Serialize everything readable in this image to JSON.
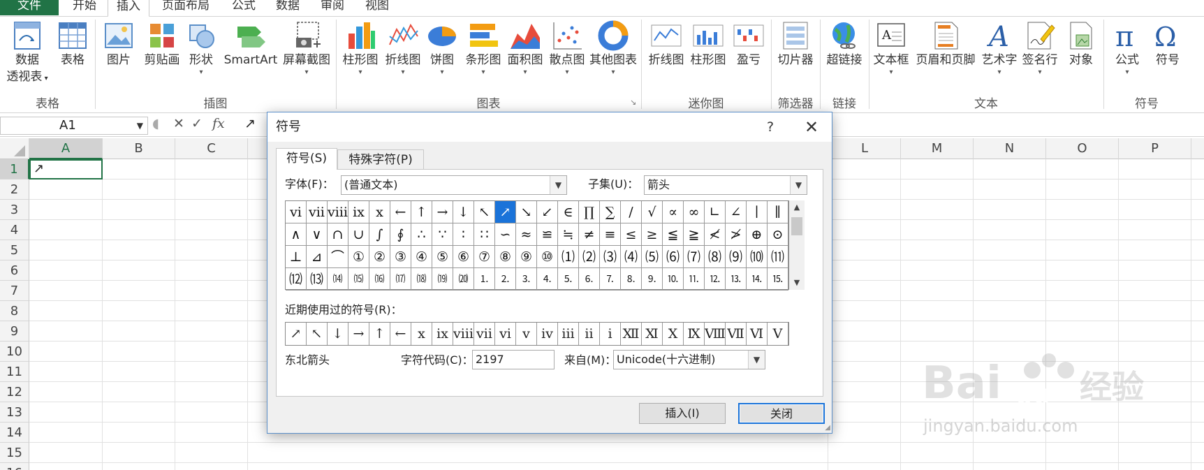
{
  "menu": {
    "tabs": [
      "文件",
      "开始",
      "插入",
      "页面布局",
      "公式",
      "数据",
      "审阅",
      "视图"
    ],
    "active": "插入"
  },
  "ribbon": {
    "table_group": {
      "label": "表格",
      "pivot_label_1": "数据",
      "pivot_label_2": "透视表",
      "table_label": "表格"
    },
    "illustrations_group": {
      "label": "插图",
      "picture": "图片",
      "clipart": "剪贴画",
      "shapes": "形状",
      "smartart": "SmartArt",
      "screenshot": "屏幕截图"
    },
    "charts_group": {
      "label": "图表",
      "column": "柱形图",
      "line": "折线图",
      "pie": "饼图",
      "bar": "条形图",
      "area": "面积图",
      "scatter": "散点图",
      "other": "其他图表"
    },
    "sparklines_group": {
      "label": "迷你图",
      "line": "折线图",
      "column": "柱形图",
      "winloss": "盈亏"
    },
    "filter_group": {
      "label": "筛选器",
      "slicer": "切片器"
    },
    "links_group": {
      "label": "链接",
      "hyperlink": "超链接"
    },
    "text_group": {
      "label": "文本",
      "textbox": "文本框",
      "header_footer": "页眉和页脚",
      "wordart": "艺术字",
      "signature": "签名行",
      "object": "对象"
    },
    "symbols_group": {
      "label": "符号",
      "equation": "公式",
      "symbol": "符号"
    }
  },
  "formula_bar": {
    "name_box": "A1",
    "content": "↗"
  },
  "sheet": {
    "columns": [
      "A",
      "B",
      "C",
      "",
      "",
      "",
      "",
      "",
      "",
      "",
      "",
      "L",
      "M",
      "N",
      "O",
      "P"
    ],
    "rows": [
      "1",
      "2",
      "3",
      "4",
      "5",
      "6",
      "7",
      "8",
      "9",
      "10",
      "11",
      "12",
      "13",
      "14",
      "15",
      "16"
    ],
    "a1_value": "↗"
  },
  "dialog": {
    "title": "符号",
    "help": "?",
    "close": "✕",
    "tabs": [
      "符号(S)",
      "特殊字符(P)"
    ],
    "font_label": "字体(F)：",
    "font_value": "(普通文本)",
    "subset_label": "子集(U)：",
    "subset_value": "箭头",
    "symbols": [
      [
        "ⅵ",
        "ⅶ",
        "ⅷ",
        "ⅸ",
        "ⅹ",
        "←",
        "↑",
        "→",
        "↓",
        "↖",
        "↗",
        "↘",
        "↙",
        "∈",
        "∏",
        "∑",
        "∕",
        "√",
        "∝",
        "∞",
        "∟",
        "∠",
        "∣",
        "∥"
      ],
      [
        "∧",
        "∨",
        "∩",
        "∪",
        "∫",
        "∮",
        "∴",
        "∵",
        "∶",
        "∷",
        "∽",
        "≈",
        "≌",
        "≒",
        "≠",
        "≡",
        "≤",
        "≥",
        "≦",
        "≧",
        "≮",
        "≯",
        "⊕",
        "⊙"
      ],
      [
        "⊥",
        "⊿",
        "⌒",
        "①",
        "②",
        "③",
        "④",
        "⑤",
        "⑥",
        "⑦",
        "⑧",
        "⑨",
        "⑩",
        "⑴",
        "⑵",
        "⑶",
        "⑷",
        "⑸",
        "⑹",
        "⑺",
        "⑻",
        "⑼",
        "⑽",
        "⑾"
      ],
      [
        "⑿",
        "⒀",
        "⒁",
        "⒂",
        "⒃",
        "⒄",
        "⒅",
        "⒆",
        "⒇",
        "⒈",
        "⒉",
        "⒊",
        "⒋",
        "⒌",
        "⒍",
        "⒎",
        "⒏",
        "⒐",
        "⒑",
        "⒒",
        "⒓",
        "⒔",
        "⒕",
        "⒖"
      ]
    ],
    "selected_symbol": "↗",
    "recent_label": "近期使用过的符号(R)：",
    "recent": [
      "↗",
      "↖",
      "↓",
      "→",
      "↑",
      "←",
      "ⅹ",
      "ⅸ",
      "ⅷ",
      "ⅶ",
      "ⅵ",
      "ⅴ",
      "ⅳ",
      "ⅲ",
      "ⅱ",
      "ⅰ",
      "Ⅻ",
      "Ⅺ",
      "Ⅹ",
      "Ⅸ",
      "Ⅷ",
      "Ⅶ",
      "Ⅵ",
      "Ⅴ"
    ],
    "char_name": "东北箭头",
    "code_label": "字符代码(C)：",
    "code_value": "2197",
    "from_label": "来自(M)：",
    "from_value": "Unicode(十六进制)",
    "insert_button": "插入(I)",
    "close_button": "关闭"
  },
  "watermark": {
    "brand": "Bai du 经验",
    "url": "jingyan.baidu.com"
  }
}
